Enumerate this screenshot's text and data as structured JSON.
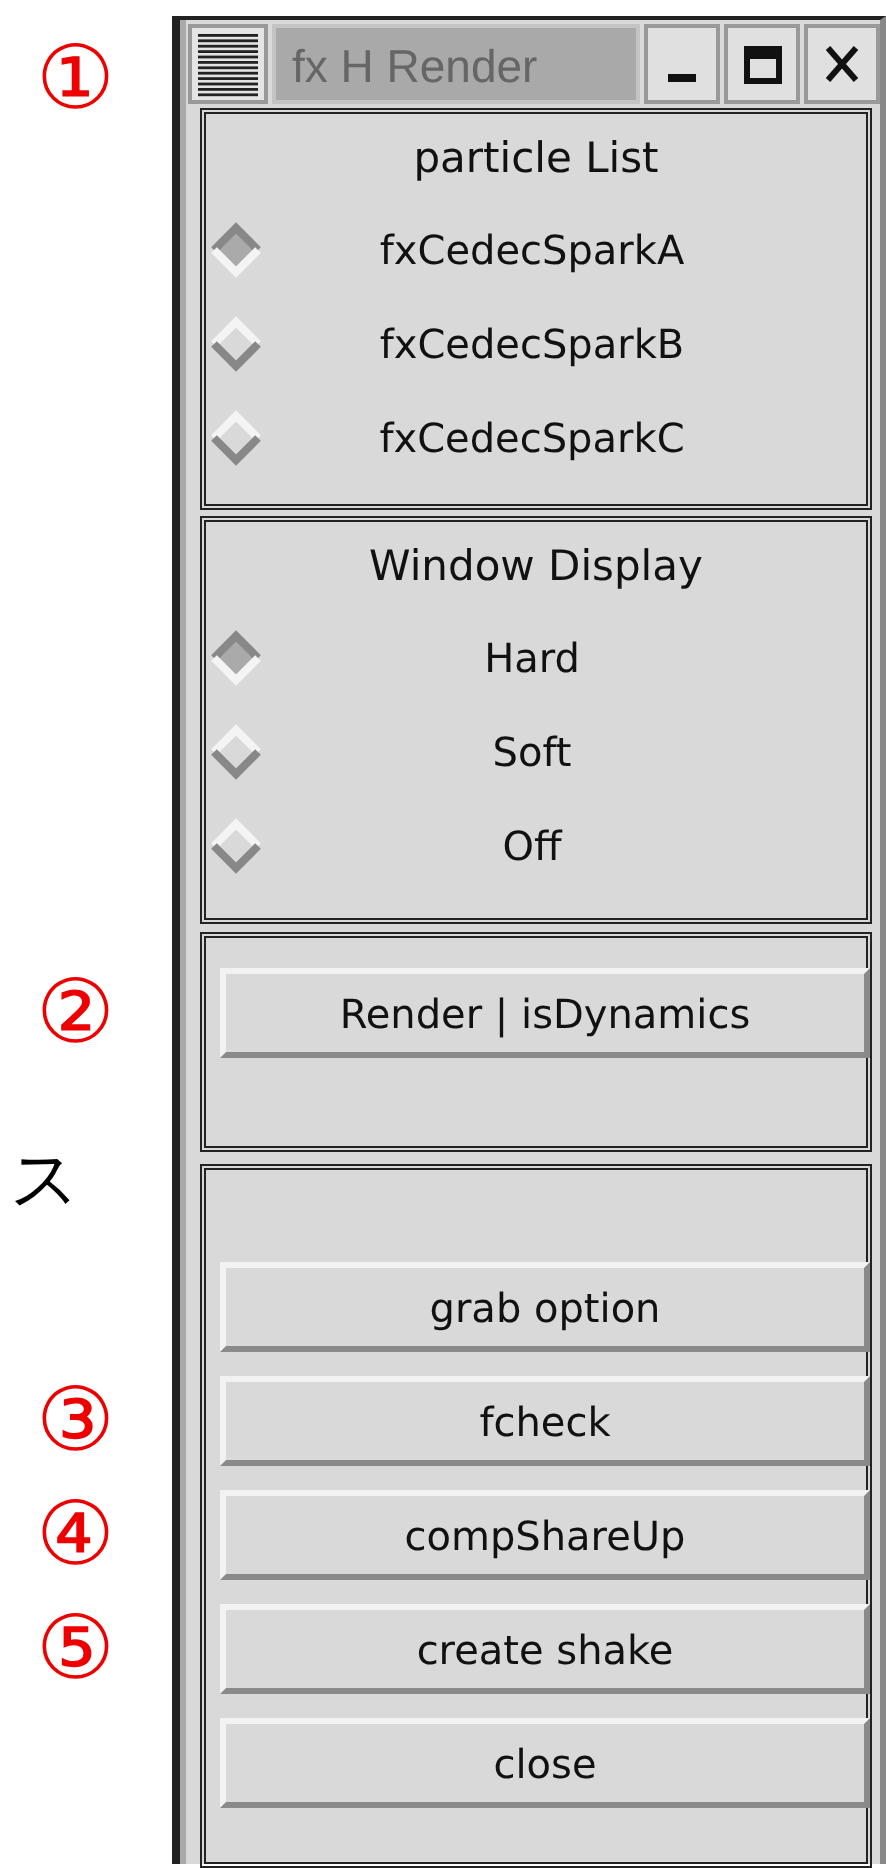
{
  "window": {
    "title": "fx H Render",
    "annotation": "①"
  },
  "radio_groups": [
    {
      "title": "particle List",
      "options": [
        {
          "label": "fxCedecSparkA",
          "selected": true
        },
        {
          "label": "fxCedecSparkB",
          "selected": false
        },
        {
          "label": "fxCedecSparkC",
          "selected": false
        }
      ]
    },
    {
      "title": "Window Display",
      "options": [
        {
          "label": "Hard",
          "selected": true
        },
        {
          "label": "Soft",
          "selected": false
        },
        {
          "label": "Off",
          "selected": false
        }
      ]
    }
  ],
  "render_section": {
    "button": {
      "label": "Render | isDynamics",
      "annotation": "②"
    },
    "side_text": "ス"
  },
  "buttons": [
    {
      "label": "grab option"
    },
    {
      "label": "fcheck",
      "annotation": "③"
    },
    {
      "label": "compShareUp",
      "annotation": "④"
    },
    {
      "label": "create shake",
      "annotation": "⑤"
    },
    {
      "label": "close"
    }
  ]
}
